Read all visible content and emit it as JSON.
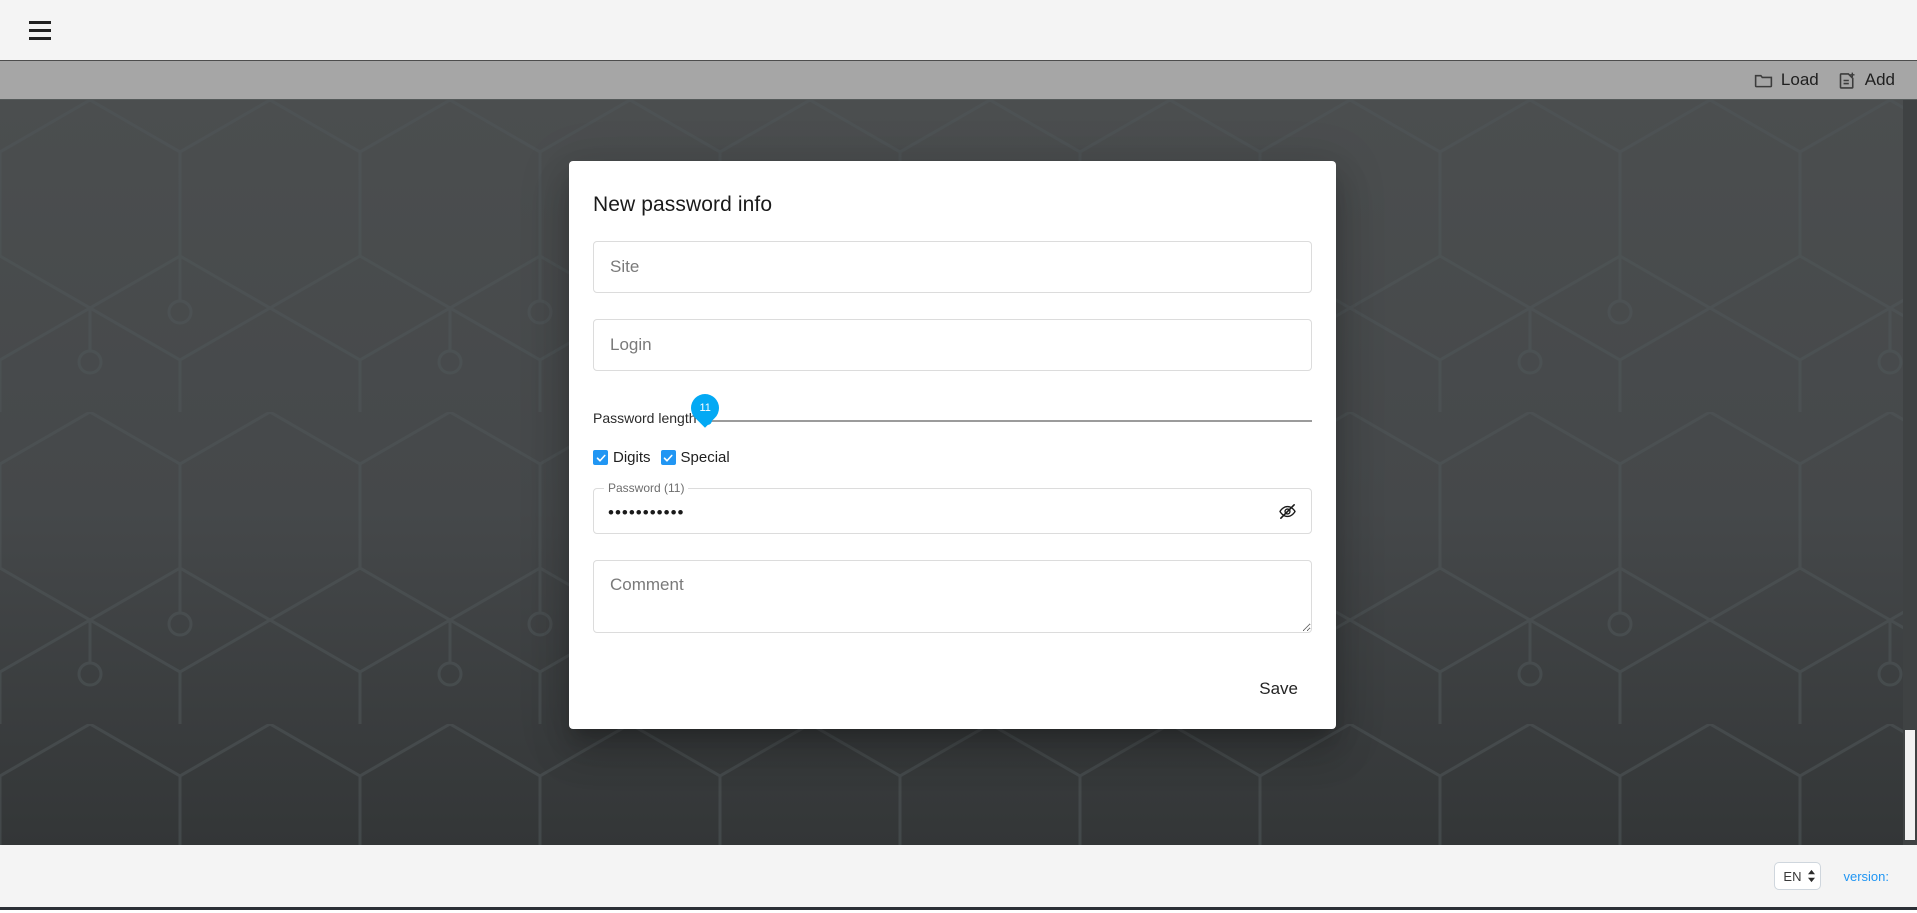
{
  "header": {
    "menu_icon": "hamburger-menu-icon"
  },
  "toolbar": {
    "actions": [
      {
        "icon": "folder-icon",
        "label": "Load"
      },
      {
        "icon": "note-add-icon",
        "label": "Add"
      }
    ]
  },
  "dialog": {
    "title": "New password info",
    "fields": {
      "site_placeholder": "Site",
      "login_placeholder": "Login",
      "comment_placeholder": "Comment"
    },
    "slider": {
      "label": "Password length",
      "value": "11",
      "min": "8",
      "max": "64",
      "percent": 0
    },
    "checkboxes": [
      {
        "label": "Digits",
        "checked": true
      },
      {
        "label": "Special",
        "checked": true
      }
    ],
    "password": {
      "legend": "Password (11)",
      "masked_value": "•••••••••••",
      "toggle_icon": "visibility-off-icon"
    },
    "save_label": "Save"
  },
  "footer": {
    "language": "EN",
    "version_label": "version:"
  },
  "colors": {
    "accent": "#03a9f4",
    "checkbox": "#2196f3",
    "link": "#2196f3",
    "background_dark": "#454849",
    "toolbar_gray": "#a6a6a6",
    "chrome_light": "#f4f4f4"
  }
}
